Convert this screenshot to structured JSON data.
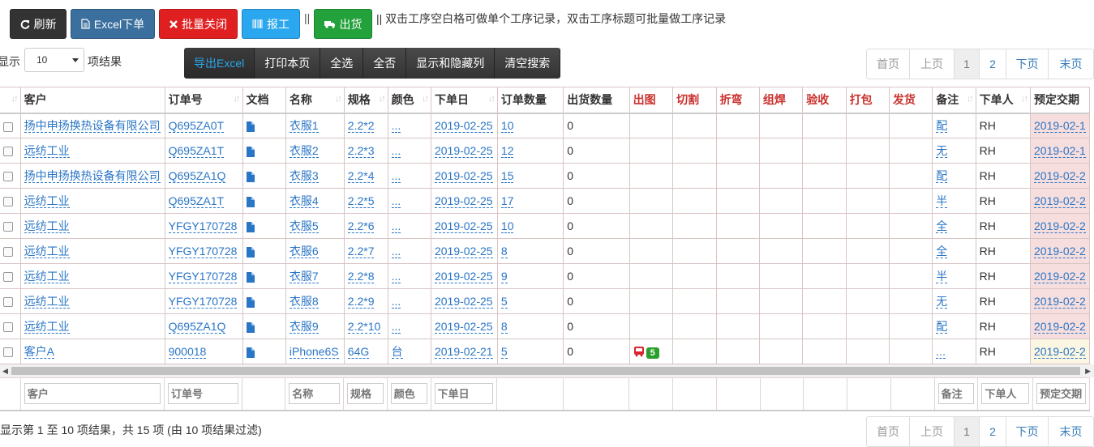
{
  "toolbar": {
    "refresh": "刷新",
    "excel_order": "Excel下单",
    "batch_close": "批量关闭",
    "report": "报工",
    "ship": "出货",
    "separator": "||",
    "hint": "|| 双击工序空白格可做单个工序记录，双击工序标题可批量做工序记录",
    "colors": {
      "refresh": "#333333",
      "excel": "#337ab7",
      "close": "#d9232d",
      "report": "#2aa7ee",
      "ship": "#23a13a"
    }
  },
  "length": {
    "prefix": "显示",
    "value": "10",
    "suffix": "项结果"
  },
  "tools": [
    "导出Excel",
    "打印本页",
    "全选",
    "全否",
    "显示和隐藏列",
    "清空搜索"
  ],
  "pager": {
    "first": "首页",
    "prev": "上页",
    "pages": [
      "1",
      "2"
    ],
    "next": "下页",
    "last": "末页"
  },
  "columns": [
    "客户",
    "订单号",
    "文档",
    "名称",
    "规格",
    "颜色",
    "下单日",
    "订单数量",
    "出货数量",
    "出图",
    "切割",
    "折弯",
    "组焊",
    "验收",
    "打包",
    "发货",
    "备注",
    "下单人",
    "预定交期"
  ],
  "rows": [
    {
      "customer": "扬中申扬换热设备有限公司",
      "order": "Q695ZA0T",
      "name": "衣服1",
      "spec": "2.2*2",
      "color": "...",
      "date": "2019-02-25",
      "qty": "10",
      "shipped": "0",
      "note": "配",
      "by": "RH",
      "due": "2019-02-1"
    },
    {
      "customer": "远纺工业",
      "order": "Q695ZA1T",
      "name": "衣服2",
      "spec": "2.2*3",
      "color": "...",
      "date": "2019-02-25",
      "qty": "12",
      "shipped": "0",
      "note": "无",
      "by": "RH",
      "due": "2019-02-1"
    },
    {
      "customer": "扬中申扬换热设备有限公司",
      "order": "Q695ZA1Q",
      "name": "衣服3",
      "spec": "2.2*4",
      "color": "...",
      "date": "2019-02-25",
      "qty": "15",
      "shipped": "0",
      "note": "配",
      "by": "RH",
      "due": "2019-02-2"
    },
    {
      "customer": "远纺工业",
      "order": "Q695ZA1T",
      "name": "衣服4",
      "spec": "2.2*5",
      "color": "...",
      "date": "2019-02-25",
      "qty": "17",
      "shipped": "0",
      "note": "半",
      "by": "RH",
      "due": "2019-02-2"
    },
    {
      "customer": "远纺工业",
      "order": "YFGY170728",
      "name": "衣服5",
      "spec": "2.2*6",
      "color": "...",
      "date": "2019-02-25",
      "qty": "10",
      "shipped": "0",
      "note": "全",
      "by": "RH",
      "due": "2019-02-2"
    },
    {
      "customer": "远纺工业",
      "order": "YFGY170728",
      "name": "衣服6",
      "spec": "2.2*7",
      "color": "...",
      "date": "2019-02-25",
      "qty": "8",
      "shipped": "0",
      "note": "全",
      "by": "RH",
      "due": "2019-02-2"
    },
    {
      "customer": "远纺工业",
      "order": "YFGY170728",
      "name": "衣服7",
      "spec": "2.2*8",
      "color": "...",
      "date": "2019-02-25",
      "qty": "9",
      "shipped": "0",
      "note": "半",
      "by": "RH",
      "due": "2019-02-2"
    },
    {
      "customer": "远纺工业",
      "order": "YFGY170728",
      "name": "衣服8",
      "spec": "2.2*9",
      "color": "...",
      "date": "2019-02-25",
      "qty": "5",
      "shipped": "0",
      "note": "无",
      "by": "RH",
      "due": "2019-02-2"
    },
    {
      "customer": "远纺工业",
      "order": "Q695ZA1Q",
      "name": "衣服9",
      "spec": "2.2*10",
      "color": "...",
      "date": "2019-02-25",
      "qty": "8",
      "shipped": "0",
      "note": "配",
      "by": "RH",
      "due": "2019-02-2"
    },
    {
      "customer": "客户A",
      "order": "900018",
      "name": "iPhone6S",
      "spec": "64G",
      "color": "台",
      "date": "2019-02-21",
      "qty": "5",
      "shipped": "0",
      "note": "...",
      "by": "RH",
      "due": "2019-02-2",
      "drawing_badge": "5"
    }
  ],
  "filters": {
    "customer": "客户",
    "order": "订单号",
    "name": "名称",
    "spec": "规格",
    "color": "颜色",
    "date": "下单日",
    "note": "备注",
    "by": "下单人",
    "due": "预定交期"
  },
  "info": "显示第 1 至 10 项结果，共 15 项 (由 10 项结果过滤)"
}
